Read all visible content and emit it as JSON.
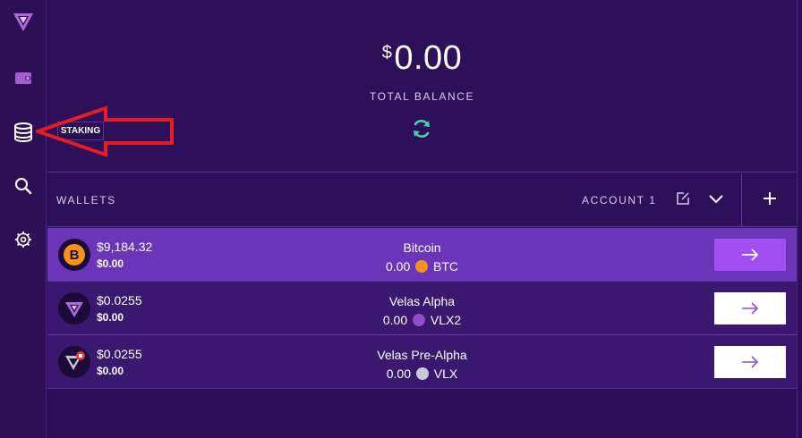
{
  "sidebar": {
    "items": [
      {
        "name": "logo",
        "icon": "velas-logo-icon"
      },
      {
        "name": "wallet",
        "icon": "wallet-icon"
      },
      {
        "name": "staking",
        "icon": "database-icon",
        "tooltip": "STAKING"
      },
      {
        "name": "search",
        "icon": "search-icon"
      },
      {
        "name": "settings",
        "icon": "gear-icon"
      }
    ]
  },
  "balance": {
    "currency": "$",
    "amount": "0.00",
    "label": "TOTAL BALANCE"
  },
  "wallets": {
    "title": "WALLETS",
    "account": "ACCOUNT 1",
    "rows": [
      {
        "usd_price": "$9,184.32",
        "usd_total": "$0.00",
        "name": "Bitcoin",
        "balance": "0.00",
        "ticker": "BTC",
        "icon": "bitcoin-icon",
        "active": true
      },
      {
        "usd_price": "$0.0255",
        "usd_total": "$0.00",
        "name": "Velas Alpha",
        "balance": "0.00",
        "ticker": "VLX2",
        "icon": "velas-icon",
        "active": false
      },
      {
        "usd_price": "$0.0255",
        "usd_total": "$0.00",
        "name": "Velas Pre-Alpha",
        "balance": "0.00",
        "ticker": "VLX",
        "icon": "velas-legacy-icon",
        "active": false
      }
    ]
  },
  "colors": {
    "background": "#2c0f58",
    "active_row": "#6a35b8",
    "accent": "#a14ff0",
    "refresh": "#3fd1b0",
    "annotation_arrow": "#e51c23"
  }
}
